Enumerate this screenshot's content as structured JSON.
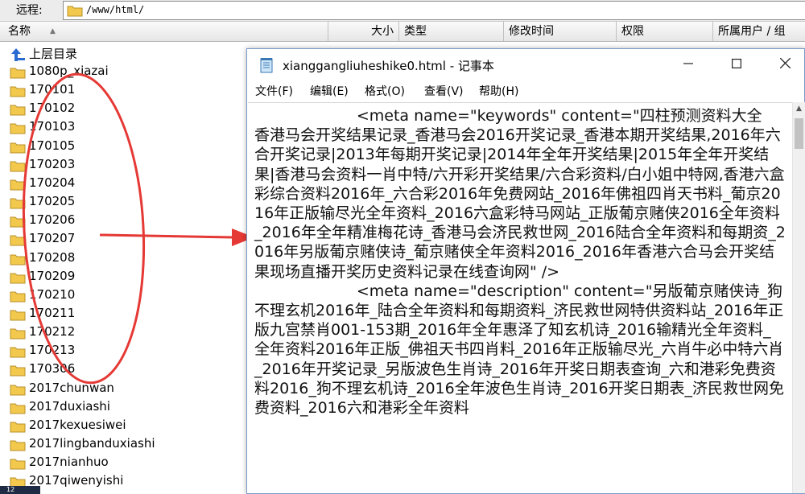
{
  "remote_bar": {
    "label": "远程:",
    "path": "/www/html/"
  },
  "columns": {
    "name": "名称",
    "size": "大小",
    "type": "类型",
    "modified": "修改时间",
    "permissions": "权限",
    "owner": "所属用户 / 组"
  },
  "file_list": {
    "parent": "上层目录",
    "folders": [
      "1080p_xiazai",
      "170101",
      "170102",
      "170103",
      "170105",
      "170203",
      "170204",
      "170205",
      "170206",
      "170207",
      "170208",
      "170209",
      "170210",
      "170211",
      "170212",
      "170213",
      "170306",
      "2017chunwan",
      "2017duxiashi",
      "2017kexuesiwei",
      "2017lingbanduxiashi",
      "2017nianhuo",
      "2017qiwenyishi"
    ]
  },
  "colors": {
    "annotation": "#e53935",
    "folder": "#f2c94c",
    "folder_edge": "#b8902a",
    "parent_arrow": "#2a6bd1"
  },
  "notepad": {
    "title": "xianggangliuheshike0.html - 记事本",
    "menu": {
      "file": "文件(F)",
      "edit": "编辑(E)",
      "format": "格式(O)",
      "view": "查看(V)",
      "help": "帮助(H)"
    },
    "content": "                     <meta name=\"keywords\" content=\"四柱预测资料大全\n香港马会开奖结果记录_香港马会2016开奖记录_香港本期开奖结果,2016年六合开奖记录|2013年每期开奖记录|2014年全年开奖结果|2015年全年开奖结果|香港马会资料一肖中特/六开彩开奖结果/六合彩资料/白小姐中特网,香港六盒彩综合资料2016年_六合彩2016年免费网站_2016年佛祖四肖天书料_葡京2016年正版输尽光全年资料_2016六盒彩特马网站_正版葡京赌侠2016全年资料_2016年全年精准梅花诗_香港马会济民救世网_2016陆合全年资料和每期资_2016年另版葡京赌侠诗_葡京赌侠全年资料2016_2016年香港六合马会开奖结果现场直播开奖历史资料记录在线查询网\" />\n                     <meta name=\"description\" content=\"另版葡京赌侠诗_狗不理玄机2016年_陆合全年资料和每期资料_济民救世网特供资料站_2016年正版九宫禁肖001-153期_2016年全年惠泽了知玄机诗_2016输精光全年资料_全年资料2016年正版_佛祖天书四肖料_2016年正版输尽光_六肖牛必中特六肖_2016年开奖记录_另版波色生肖诗_2016年开奖日期表查询_六和港彩免费资料2016_狗不理玄机诗_2016全年波色生肖诗_2016开奖日期表_济民救世网免费资料_2016六和港彩全年资料"
  },
  "badge": "12"
}
